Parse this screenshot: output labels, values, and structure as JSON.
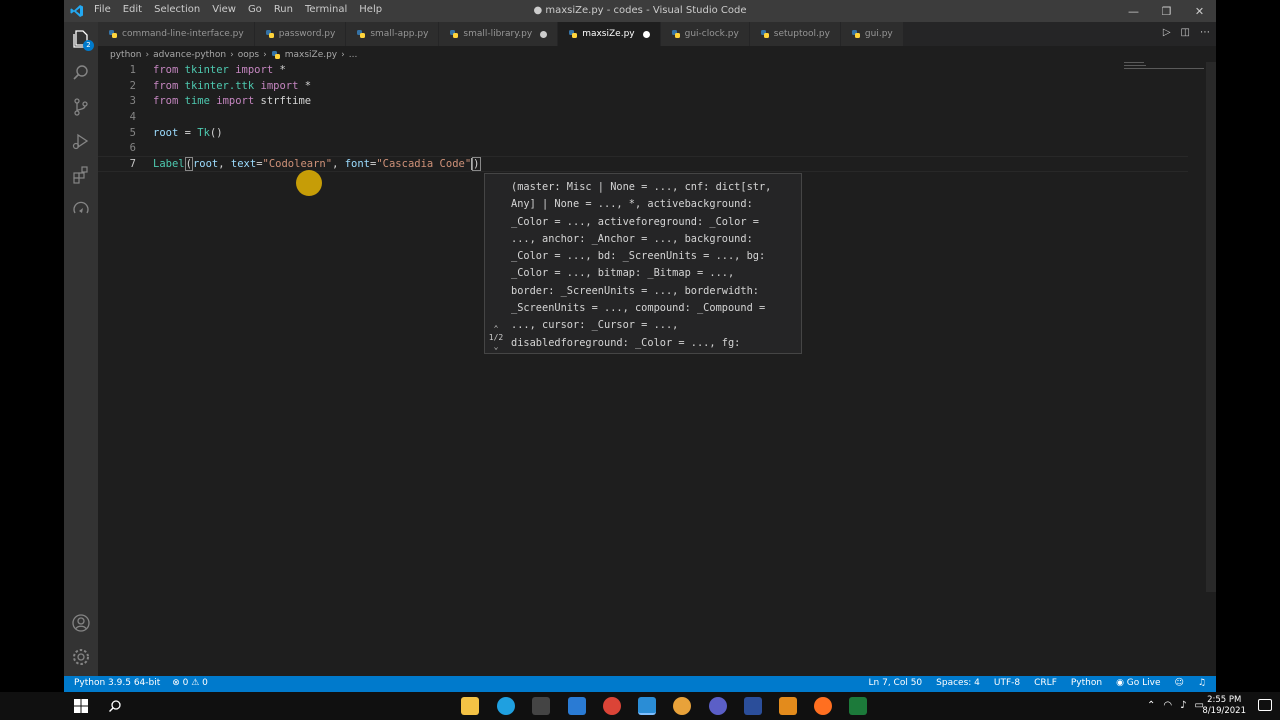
{
  "window": {
    "title": "● maxsiZe.py - codes - Visual Studio Code",
    "menu": [
      "File",
      "Edit",
      "Selection",
      "View",
      "Go",
      "Run",
      "Terminal",
      "Help"
    ],
    "controls": [
      "—",
      "❐",
      "✕"
    ]
  },
  "activity": {
    "explorer_badge": "2"
  },
  "tabs": [
    {
      "label": "command-line-interface.py",
      "active": false,
      "modified": false
    },
    {
      "label": "password.py",
      "active": false,
      "modified": false
    },
    {
      "label": "small-app.py",
      "active": false,
      "modified": false
    },
    {
      "label": "small-library.py",
      "active": false,
      "modified": true
    },
    {
      "label": "maxsiZe.py",
      "active": true,
      "modified": true
    },
    {
      "label": "gui-clock.py",
      "active": false,
      "modified": false
    },
    {
      "label": "setuptool.py",
      "active": false,
      "modified": false
    },
    {
      "label": "gui.py",
      "active": false,
      "modified": false
    }
  ],
  "breadcrumb": [
    "python",
    "advance-python",
    "oops",
    "maxsiZe.py",
    "..."
  ],
  "editor": {
    "line_numbers": [
      "1",
      "2",
      "3",
      "4",
      "5",
      "6",
      "7"
    ],
    "l1": {
      "kw1": "from",
      "mod": "tkinter",
      "kw2": "import",
      "rest": "*"
    },
    "l2": {
      "kw1": "from",
      "mod": "tkinter.ttk",
      "kw2": "import",
      "rest": "*"
    },
    "l3": {
      "kw1": "from",
      "mod": "time",
      "kw2": "import",
      "rest": "strftime"
    },
    "l5": {
      "var": "root",
      "op": " = ",
      "fn": "Tk",
      "rest": "()"
    },
    "l7": {
      "fn": "Label",
      "p1": "(",
      "arg": "root",
      "p2": ", ",
      "kw_text": "text",
      "eq1": "=",
      "str1": "\"Codolearn\"",
      "p3": ", ",
      "kw_font": "font",
      "eq2": "=",
      "str2": "\"Cascadia Code\"",
      "close": ")"
    }
  },
  "signature_help": {
    "counter": "1/2",
    "text": "(master: Misc | None = ..., cnf: dict[str,\nAny] | None = ..., *, activebackground:\n_Color = ..., activeforeground: _Color =\n..., anchor: _Anchor = ..., background:\n_Color = ..., bd: _ScreenUnits = ..., bg:\n_Color = ..., bitmap: _Bitmap = ...,\nborder: _ScreenUnits = ..., borderwidth:\n_ScreenUnits = ..., compound: _Compound =\n..., cursor: _Cursor = ...,\ndisabledforeground: _Color = ..., fg:"
  },
  "statusbar": {
    "interpreter": "Python 3.9.5 64-bit",
    "problems": "⊗ 0 ⚠ 0",
    "position": "Ln 7, Col 50",
    "spaces": "Spaces: 4",
    "encoding": "UTF-8",
    "eol": "CRLF",
    "language": "Python",
    "golive": "Go Live"
  },
  "taskbar": {
    "time": "2:55 PM",
    "date": "8/19/2021"
  },
  "colors": {
    "accent": "#007acc",
    "keyword": "#c586c0",
    "type": "#4ec9b0",
    "string": "#ce9178",
    "variable": "#9cdcfe"
  }
}
